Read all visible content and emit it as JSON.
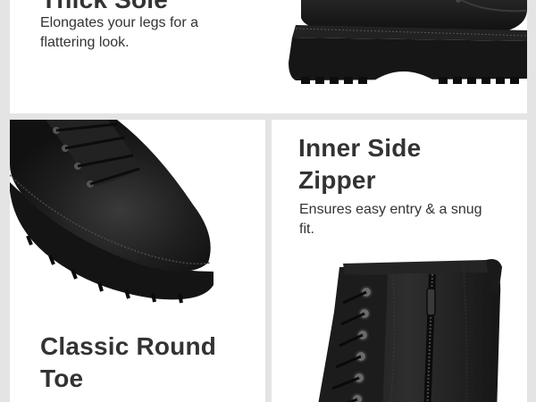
{
  "features": [
    {
      "title": "Thick Sole",
      "description": "Elongates your legs for a flattering look.",
      "image_icon": "boot-thick-sole-image"
    },
    {
      "title": "Classic Round Toe",
      "description": "",
      "image_icon": "boot-round-toe-image"
    },
    {
      "title": "Inner Side Zipper",
      "description": "Ensures easy entry & a snug fit.",
      "image_icon": "boot-side-zipper-image"
    }
  ],
  "colors": {
    "background": "#e4e4e4",
    "panel": "#ffffff",
    "text": "#333333",
    "boot": "#1b1b1b"
  }
}
